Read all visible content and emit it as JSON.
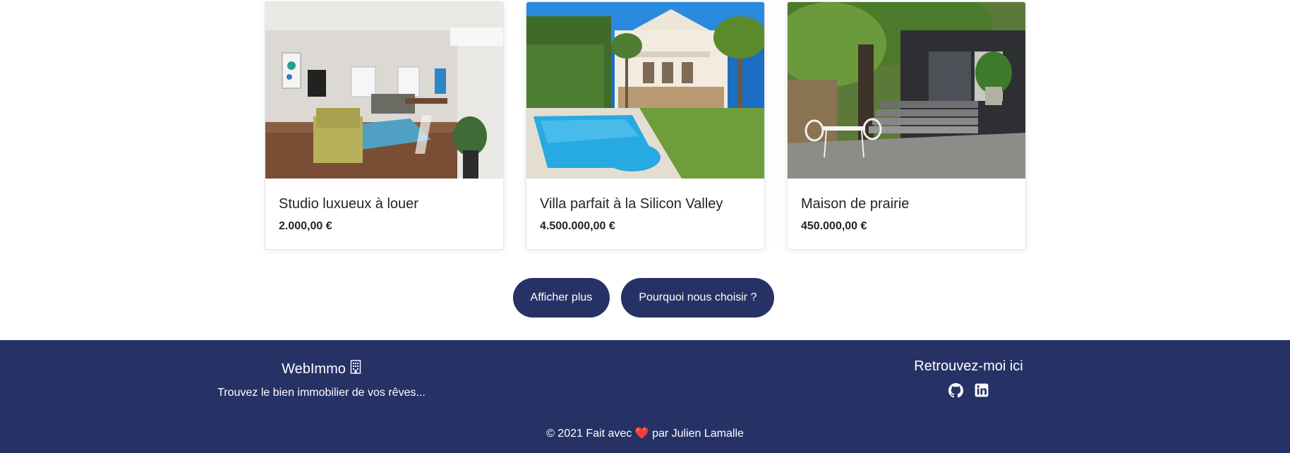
{
  "listings": [
    {
      "title": "Studio luxueux à louer",
      "price": "2.000,00 €",
      "image": "living-room-photo"
    },
    {
      "title": "Villa parfait à la Silicon Valley",
      "price": "4.500.000,00 €",
      "image": "villa-pool-photo"
    },
    {
      "title": "Maison de prairie",
      "price": "450.000,00 €",
      "image": "garden-terrace-photo"
    }
  ],
  "actions": {
    "show_more": "Afficher plus",
    "why_us": "Pourquoi nous choisir ?"
  },
  "footer": {
    "brand": "WebImmo",
    "brand_icon": "building-icon",
    "tagline": "Trouvez le bien immobilier de vos rêves...",
    "social_title": "Retrouvez-moi ici",
    "social_icons": [
      "github-icon",
      "linkedin-icon"
    ],
    "copyright_prefix": "© 2021 Fait avec",
    "heart": "❤️",
    "copyright_suffix": "par Julien Lamalle"
  },
  "colors": {
    "primary": "#263266",
    "heart": "#e0242f"
  }
}
